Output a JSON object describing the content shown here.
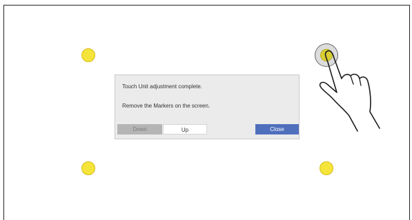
{
  "dialog": {
    "message_line1": "Touch Unit adjustment complete.",
    "message_line2": "Remove the Markers on the screen.",
    "buttons": {
      "down": "Down",
      "up": "Up",
      "close": "Close"
    }
  },
  "colors": {
    "marker": "#f5e43a",
    "close_button": "#4f6fbd",
    "dialog_background": "#ebebeb"
  },
  "icons": {
    "pointer": "hand-pointer-icon"
  }
}
